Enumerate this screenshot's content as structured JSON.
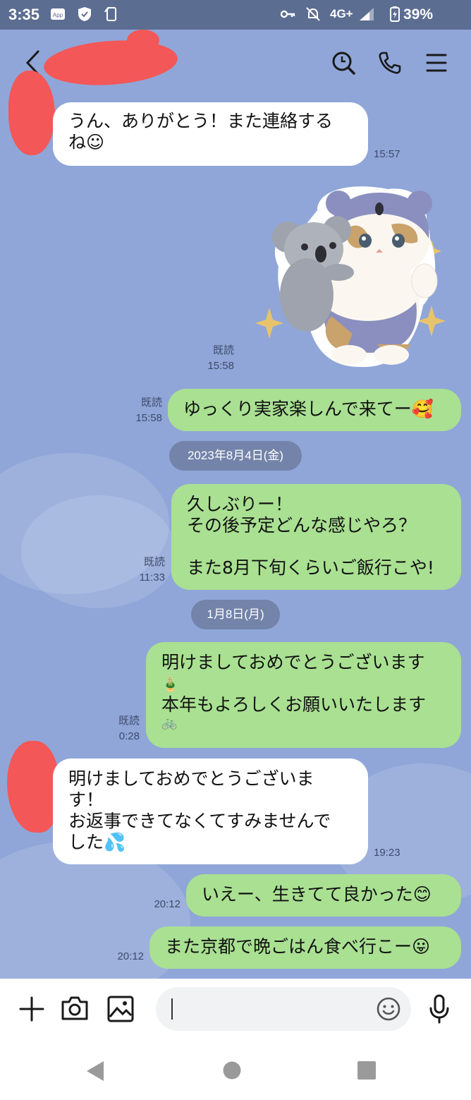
{
  "status_bar": {
    "time": "3:35",
    "network": "4G+",
    "battery": "39%"
  },
  "header": {
    "contact_name": ""
  },
  "messages": {
    "m1": {
      "lines": [
        "うん、ありがとう！また連絡する",
        "ね☺"
      ],
      "time": "15:57"
    },
    "sticker": {
      "read": "既読",
      "time": "15:58"
    },
    "m2": {
      "text": "ゆっくり実家楽しんで来てー🥰",
      "read": "既読",
      "time": "15:58"
    },
    "date1": "2023年8月4日(金)",
    "m3": {
      "lines": [
        "久しぶりー！",
        "その後予定どんな感じやろ？",
        "",
        "また8月下旬くらいご飯行こや!"
      ],
      "read": "既読",
      "time": "11:33"
    },
    "date2": "1月8日(月)",
    "m4": {
      "lines": [
        "明けましておめでとうございます",
        "🎍",
        "本年もよろしくお願いいたします",
        "🚲"
      ],
      "read": "既読",
      "time": "0:28"
    },
    "m5": {
      "lines": [
        "明けましておめでとうございま",
        "す！",
        "お返事できてなくてすみませんで",
        "した💦"
      ],
      "time": "19:23"
    },
    "m6": {
      "text": "いえー、生きてて良かった😊",
      "time": "20:12"
    },
    "m7": {
      "text": "また京都で晩ごはん食べ行こー😛",
      "time": "20:12"
    }
  },
  "input": {
    "placeholder": ""
  },
  "icons": [
    "back-icon",
    "search-icon",
    "phone-icon",
    "menu-icon",
    "plus-icon",
    "camera-icon",
    "image-icon",
    "emoji-icon",
    "mic-icon"
  ],
  "colors": {
    "chat_background": "#90a6d8",
    "incoming_bubble": "#ffffff",
    "outgoing_bubble": "#a9e092",
    "date_chip": "#7383a9",
    "status_bar": "#5c6d92"
  }
}
